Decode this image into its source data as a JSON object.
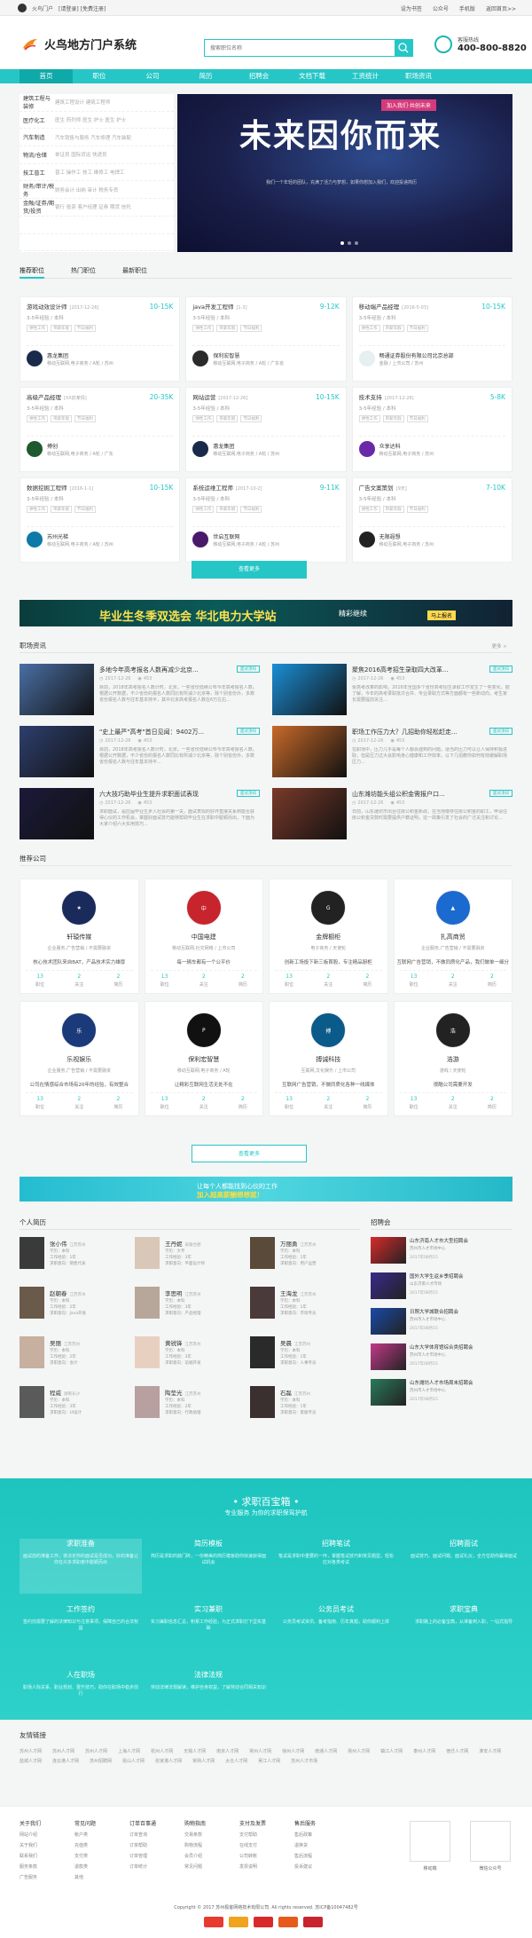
{
  "topbar": {
    "site_name": "火鸟门户",
    "login_links": "[请登录] [免费注册]",
    "right": [
      "设为书签",
      "公众号",
      "手机版",
      "返回首页>>"
    ]
  },
  "header": {
    "logo_text": "火鸟地方门户系统",
    "search_placeholder": "搜索职位名称",
    "hotline_label": "客服热线",
    "hotline_number": "400-800-8820"
  },
  "nav": [
    "首页",
    "职位",
    "公司",
    "简历",
    "招聘会",
    "文档下载",
    "工资统计",
    "职场资讯"
  ],
  "categories": [
    {
      "name": "建筑工程与装修",
      "subs": "建筑工程设计 建筑工程师"
    },
    {
      "name": "医疗化工",
      "subs": "医生 药剂师 医生 护士 医生 护士"
    },
    {
      "name": "汽车制造",
      "subs": "汽车销售与服务 汽车修理 汽车装配"
    },
    {
      "name": "物流/仓储",
      "subs": "单证员 国际货运 快递员"
    },
    {
      "name": "技工普工",
      "subs": "普工 操作工 技工 维修工 电焊工"
    },
    {
      "name": "财务/审计/税务",
      "subs": "财务会计 出纳 审计 税务专员"
    },
    {
      "name": "金融/证券/期货/投资",
      "subs": "银行 投资 客户经理 证券 期货 信托"
    },
    {
      "name": "",
      "subs": ""
    },
    {
      "name": "",
      "subs": ""
    }
  ],
  "banner": {
    "title": "未来因你而来",
    "tag": "加入我们·共创未来",
    "subtitle": "我们一个年轻的团队，充满了活力与梦想，如果你想加入我们，欢迎投递简历"
  },
  "tabs": [
    "推荐职位",
    "热门职位",
    "最新职位"
  ],
  "jobs": [
    {
      "title": "游戏动效设计师",
      "date": "[2017-12-26]",
      "salary": "10-15K",
      "req": "3-5年经验 / 本科",
      "tags": [
        "弹性工作",
        "带薪年假",
        "节日福利"
      ],
      "company": "惠龙集团",
      "info": "移动互联网,电子商务 / A轮 / 苏州",
      "logo": "#1a2a4a"
    },
    {
      "title": "java开发工程师",
      "date": "[1-3]",
      "salary": "9-12K",
      "req": "3-5年经验 / 本科",
      "tags": [
        "弹性工作",
        "带薪年假",
        "节日福利"
      ],
      "company": "保利宏智慧",
      "info": "移动互联网,电子商务 / A轮 / 广东省",
      "logo": "#2b2b2b"
    },
    {
      "title": "移动端产品经理",
      "date": "[2016-5-03]",
      "salary": "10-15K",
      "req": "3-5年经验 / 本科",
      "tags": [
        "弹性工作",
        "带薪年假",
        "节日福利"
      ],
      "company": "畅通证券股份有限公司北京总部",
      "info": "金融 / 上市公司 / 苏州",
      "logo": "#e6f0f0"
    },
    {
      "title": "高级产品经理",
      "date": "[XX前某情]",
      "salary": "20-35K",
      "req": "3-5年经验 / 本科",
      "tags": [
        "弹性工作",
        "带薪年假",
        "节日福利"
      ],
      "company": "搏创",
      "info": "移动互联网,电子商务 / A轮 / 广东",
      "logo": "#1f5a2f"
    },
    {
      "title": "网站运营",
      "date": "[2017-12-26]",
      "salary": "10-15K",
      "req": "3-5年经验 / 本科",
      "tags": [
        "弹性工作",
        "带薪年假",
        "节日福利"
      ],
      "company": "惠龙集团",
      "info": "移动互联网,电子商务 / A轮 / 苏州",
      "logo": "#1a2a4a"
    },
    {
      "title": "技术支持",
      "date": "[2017-12-26]",
      "salary": "5-8K",
      "req": "3-5年经验 / 本科",
      "tags": [
        "弹性工作",
        "带薪年假",
        "节日福利"
      ],
      "company": "众享达科",
      "info": "移动互联网,电子商务 / 苏州",
      "logo": "#6a2aa8"
    },
    {
      "title": "数据挖掘工程师",
      "date": "[2016-1-1]",
      "salary": "10-15K",
      "req": "3-5年经验 / 本科",
      "tags": [
        "弹性工作",
        "带薪年假",
        "节日福利"
      ],
      "company": "苏州光梯",
      "info": "移动互联网,电子商务 / A轮 / 苏州",
      "logo": "#0e7aa8"
    },
    {
      "title": "系统运维工程师",
      "date": "[2017-10-2]",
      "salary": "9-11K",
      "req": "3-5年经验 / 本科",
      "tags": [
        "弹性工作",
        "带薪年假",
        "节日福利"
      ],
      "company": "世启互联网",
      "info": "移动互联网,电子商务 / A轮 / 苏州",
      "logo": "#4a1a6a"
    },
    {
      "title": "广告文案策划",
      "date": "[9天]",
      "salary": "7-10K",
      "req": "3-5年经验 / 本科",
      "tags": [
        "弹性工作",
        "带薪年假",
        "节日福利"
      ],
      "company": "无限遐想",
      "info": "移动互联网,电子商务 / 苏州",
      "logo": "#222"
    }
  ],
  "jobs_more": "查看更多",
  "ad1": {
    "title": "毕业生冬季双选会 华北电力大学站",
    "cta": "精彩继续",
    "badge": "马上报名"
  },
  "news_section": {
    "title": "职场资讯",
    "more": "更多 >"
  },
  "news": [
    {
      "title": "多地今年高考报名人数再减少北京...",
      "badge": "面试须知",
      "date": "2017-12-26",
      "views": "453",
      "desc": "目前，2018年高考报名人数计时，北京，一些省份陆续公布今年高考报名人数。根据公开数据，不少省份的报名人数同比有所减少北京等，除个别省份外，多数省份报名人数与往年基本持平，其中北京高考报名人数在6万左右...",
      "img": "#4a6fa5"
    },
    {
      "title": "聚焦2016高考招生录取四大改革...",
      "badge": "面试须知",
      "date": "2017-12-26",
      "views": "453",
      "desc": "受高考改革的影响，2016年全国多个省份高考招生录取工作发生了一些变化，据了解，今年的高考录取批次合并、专业录取方式等方面都有一些新动向，考生家长需要提前关注...",
      "img": "#1b8fd6"
    },
    {
      "title": "\"史上最严\"高考\"首日见闻：9402万...",
      "badge": "面试须知",
      "date": "2017-12-26",
      "views": "453",
      "desc": "目前，2018年高考报名人数计时，北京，一些省份陆续公布今年高考报名人数。根据公开数据，不少省份的报名人数同比有所减少北京等，除个别省份外，多数省份报名人数与往年基本持平...",
      "img": "#2e3f6e"
    },
    {
      "title": "职场工作压力大？几招助你轻松赶走...",
      "badge": "面试须知",
      "date": "2017-12-26",
      "views": "453",
      "desc": "在职场中，压力几乎是每个人都会遇到的问题，适当的压力可以让人保持积极进取，但是压力过大会影响身心健康和工作效率，以下几招教你如何有效缓解职场压力...",
      "img": "#c86a2a"
    },
    {
      "title": "六大技巧助毕业生提升求职面试表现",
      "badge": "面试须知",
      "date": "2017-12-26",
      "views": "453",
      "desc": "求职面试，是应届毕业生步入社会的第一关，面试表现的好坏直接关系到能否获得心仪的工作机会，掌握好面试技巧能够帮助毕业生在求职中脱颖而出，下面为大家介绍六大实用技巧...",
      "img": "#1a1a3a"
    },
    {
      "title": "山东潍坊能头组公积金需报户口...",
      "badge": "面试须知",
      "date": "2017-12-26",
      "views": "453",
      "desc": "日前，山东潍坊市出台住房公积金新政，在当地缴存住房公积金的职工，申请住房公积金贷款时需要提供户籍证明，这一政策引发了社会的广泛关注和讨论...",
      "img": "#7a3a2a"
    }
  ],
  "company_section": {
    "title": "推荐公司"
  },
  "companies": [
    {
      "name": "轩辕传媒",
      "info": "企业服务,广告营销 / 不需要融资",
      "desc": "核心技术团队来自BAT，产品技术实力雄厚",
      "jobs": "13",
      "follow": "2",
      "resume": "2",
      "logo": "#1a2a5a",
      "mark": "★"
    },
    {
      "name": "中国电建",
      "info": "移动互联网,社交网络 / 上市公司",
      "desc": "每一辆车都有一个公平价",
      "jobs": "13",
      "follow": "2",
      "resume": "2",
      "logo": "#c8242e",
      "mark": "中"
    },
    {
      "name": "金牌橱柜",
      "info": "电子商务 / 天使轮",
      "desc": "创新工场投下新三板首股，专注精品厨柜",
      "jobs": "13",
      "follow": "2",
      "resume": "2",
      "logo": "#222",
      "mark": "G"
    },
    {
      "name": "扎高商贸",
      "info": "企业服务,广告营销 / 不需要融资",
      "desc": "互联网广告营销，不做同质化产品，我们做单一细分",
      "jobs": "13",
      "follow": "2",
      "resume": "2",
      "logo": "#1a6ad0",
      "mark": "▲"
    },
    {
      "name": "乐视娱乐",
      "info": "企业服务,广告营销 / 不需要融资",
      "desc": "公司在情感综合市场有20年的经验，有效整合",
      "jobs": "13",
      "follow": "2",
      "resume": "2",
      "logo": "#1a3a7a",
      "mark": "乐"
    },
    {
      "name": "保利宏智慧",
      "info": "移动互联网,电子商务 / A轮",
      "desc": "让精彩互联网生活无处不在",
      "jobs": "13",
      "follow": "2",
      "resume": "2",
      "logo": "#111",
      "mark": "P"
    },
    {
      "name": "搏诚科技",
      "info": "互联网,文化娱乐 / 上市公司",
      "desc": "互联网广告营销，不做同质化各种一线媒体",
      "jobs": "13",
      "follow": "2",
      "resume": "2",
      "logo": "#0a5a8a",
      "mark": "搏"
    },
    {
      "name": "浩游",
      "info": "游戏 / 天使轮",
      "desc": "很酷公司需要开发",
      "jobs": "13",
      "follow": "2",
      "resume": "2",
      "logo": "#222",
      "mark": "浩"
    }
  ],
  "company_stat_labels": [
    "职位",
    "关注",
    "简历"
  ],
  "companies_more": "查看更多",
  "ad2": {
    "line1": "让每个人都能找到心仪的工作",
    "line2": "加入超高薪酬想想就！"
  },
  "resume_section": {
    "title": "个人简历"
  },
  "resumes": [
    {
      "name": "张小伟",
      "loc": "江苏苏州",
      "edu": "本科",
      "exp": "1年",
      "want": "销售代表"
    },
    {
      "name": "王丹妮",
      "loc": "安徽合肥",
      "edu": "大专",
      "exp": "3年",
      "want": "平面设计师"
    },
    {
      "name": "万丽勇",
      "loc": "江苏苏州",
      "edu": "本科",
      "exp": "1年",
      "want": "用户运营"
    },
    {
      "name": "赵朝春",
      "loc": "江苏苏州",
      "edu": "本科",
      "exp": "2年",
      "want": "Java开发"
    },
    {
      "name": "李思明",
      "loc": "江苏苏州",
      "edu": "本科",
      "exp": "3年",
      "want": "产品经理"
    },
    {
      "name": "王海龙",
      "loc": "江苏苏州",
      "edu": "本科",
      "exp": "1年",
      "want": "市场专员"
    },
    {
      "name": "吴丽",
      "loc": "江苏苏州",
      "edu": "本科",
      "exp": "2年",
      "want": "会计"
    },
    {
      "name": "黄锐锋",
      "loc": "江苏苏州",
      "edu": "本科",
      "exp": "3年",
      "want": "前端开发"
    },
    {
      "name": "吴晨",
      "loc": "江苏苏州",
      "edu": "本科",
      "exp": "1年",
      "want": "人事专员"
    },
    {
      "name": "程威",
      "loc": "湖南长沙",
      "edu": "本科",
      "exp": "3年",
      "want": "UI设计"
    },
    {
      "name": "陶莹光",
      "loc": "江苏苏州",
      "edu": "本科",
      "exp": "2年",
      "want": "行政助理"
    },
    {
      "name": "石磊",
      "loc": "江苏苏州",
      "edu": "本科",
      "exp": "1年",
      "want": "客服专员"
    }
  ],
  "resume_field_labels": {
    "edu": "学历：",
    "exp": "工作经验：",
    "want": "求职意向："
  },
  "fair_section": {
    "title": "招聘会"
  },
  "fairs": [
    {
      "title": "山东济南人才市大型招聘会",
      "sub": "苏州市人才市场中心",
      "date": "2017年08月15",
      "img": "#d92a2a"
    },
    {
      "title": "国外大学生返乡季招聘会",
      "sub": "山东济南人才市场",
      "date": "2017年08月15",
      "img": "#3a2a8a"
    },
    {
      "title": "日照大学城联合招聘会",
      "sub": "苏州市人才市场中心",
      "date": "2017年08月15",
      "img": "#1a4aa8"
    },
    {
      "title": "山东大学体育馆综合类招聘会",
      "sub": "苏州市人才市场中心",
      "date": "2017年08月15",
      "img": "#c23a8a"
    },
    {
      "title": "山东潍坊人才市场周末招聘会",
      "sub": "苏州市人才市场中心",
      "date": "2017年08月15",
      "img": "#2a7a5a"
    }
  ],
  "treasure": {
    "title": "• 求职百宝箱 •",
    "subtitle": "专业服务 为你的求职保驾护航",
    "items": [
      {
        "head": "求职准备",
        "desc": "面试前的准备工作，将决定你的面试是否成功，好的准备让你在众多求职者中脱颖而出"
      },
      {
        "head": "简历模板",
        "desc": "简历是求职的敲门砖，一份精美的简历模板助你快速获得面试机会"
      },
      {
        "head": "招聘笔试",
        "desc": "笔试是求职中重要的一环，掌握笔试技巧和常见题型，轻松应对各类考试"
      },
      {
        "head": "招聘面试",
        "desc": "面试技巧、面试问题、面试礼仪，全方位助你赢得面试"
      },
      {
        "head": "工作签约",
        "desc": "签约前需要了解的法律知识与注意事项，保障自己的合法权益"
      },
      {
        "head": "实习兼职",
        "desc": "实习兼职信息汇总，积累工作经验，为正式求职打下坚实基础"
      },
      {
        "head": "公务员考试",
        "desc": "公务员考试资讯、备考指南、历年真题，助你顺利上岸"
      },
      {
        "head": "求职宝典",
        "desc": "求职路上的必备宝典，从准备到入职，一站式指导"
      },
      {
        "head": "人在职场",
        "desc": "职场人际关系、职业规划、晋升技巧，助你在职场中稳步前行"
      },
      {
        "head": "法律法规",
        "desc": "劳动法律法规解读，维护自身权益，了解劳动合同相关知识"
      }
    ]
  },
  "links_section": {
    "title": "友情链接"
  },
  "links": [
    "苏州人才网",
    "苏州人才网",
    "苏州人才网",
    "上海人才网",
    "杭州人才网",
    "无锡人才网",
    "南京人才网",
    "常州人才网",
    "徐州人才网",
    "南通人才网",
    "扬州人才网",
    "镇江人才网",
    "泰州人才网",
    "宿迁人才网",
    "淮安人才网",
    "盐城人才网",
    "连云港人才网",
    "苏州招聘网",
    "昆山人才网",
    "张家港人才网",
    "常熟人才网",
    "太仓人才网",
    "吴江人才网",
    "苏州人才市场"
  ],
  "footer": {
    "cols": [
      {
        "head": "关于我们",
        "items": [
          "网站介绍",
          "关于我们",
          "联系我们",
          "服务条款",
          "广告服务"
        ]
      },
      {
        "head": "常见问题",
        "items": [
          "帐户类",
          "充值类",
          "支付类",
          "退款类",
          "其他"
        ]
      },
      {
        "head": "订单百事通",
        "items": [
          "订单查询",
          "订单帮助",
          "订单管理",
          "订单统计"
        ]
      },
      {
        "head": "购物指南",
        "items": [
          "交易条款",
          "购物流程",
          "会员介绍",
          "常见问题"
        ]
      },
      {
        "head": "支付及发票",
        "items": [
          "支付帮助",
          "在线支付",
          "公司转账",
          "发票说明"
        ]
      },
      {
        "head": "售后服务",
        "items": [
          "售后政策",
          "退换货",
          "售后流程",
          "投诉建议"
        ]
      }
    ],
    "qr_labels": [
      "移动端",
      "微信公众号"
    ],
    "copyright": "Copyright © 2017 苏州极客网络技术有限公司. All rights reserved.   苏ICP备10047482号"
  },
  "colors": {
    "accent": "#26c6c6",
    "nav_active": "#10a9a9"
  }
}
